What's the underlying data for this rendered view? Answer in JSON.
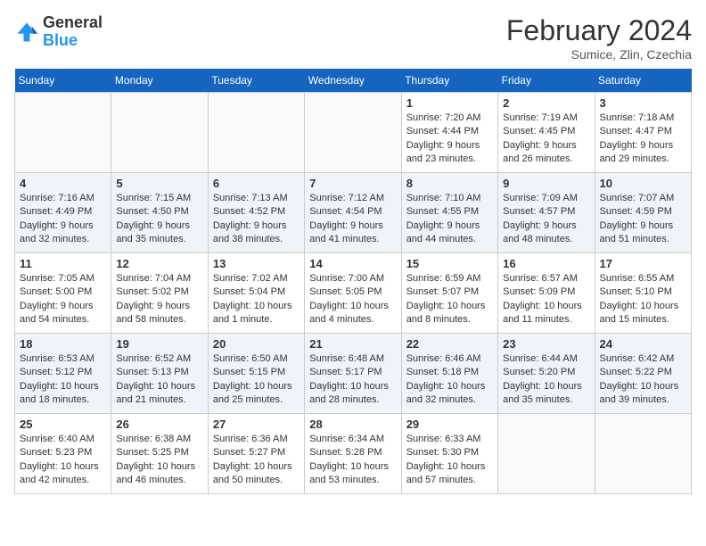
{
  "logo": {
    "general": "General",
    "blue": "Blue"
  },
  "header": {
    "month": "February 2024",
    "location": "Sumice, Zlin, Czechia"
  },
  "weekdays": [
    "Sunday",
    "Monday",
    "Tuesday",
    "Wednesday",
    "Thursday",
    "Friday",
    "Saturday"
  ],
  "weeks": [
    [
      {
        "day": "",
        "info": ""
      },
      {
        "day": "",
        "info": ""
      },
      {
        "day": "",
        "info": ""
      },
      {
        "day": "",
        "info": ""
      },
      {
        "day": "1",
        "info": "Sunrise: 7:20 AM\nSunset: 4:44 PM\nDaylight: 9 hours\nand 23 minutes."
      },
      {
        "day": "2",
        "info": "Sunrise: 7:19 AM\nSunset: 4:45 PM\nDaylight: 9 hours\nand 26 minutes."
      },
      {
        "day": "3",
        "info": "Sunrise: 7:18 AM\nSunset: 4:47 PM\nDaylight: 9 hours\nand 29 minutes."
      }
    ],
    [
      {
        "day": "4",
        "info": "Sunrise: 7:16 AM\nSunset: 4:49 PM\nDaylight: 9 hours\nand 32 minutes."
      },
      {
        "day": "5",
        "info": "Sunrise: 7:15 AM\nSunset: 4:50 PM\nDaylight: 9 hours\nand 35 minutes."
      },
      {
        "day": "6",
        "info": "Sunrise: 7:13 AM\nSunset: 4:52 PM\nDaylight: 9 hours\nand 38 minutes."
      },
      {
        "day": "7",
        "info": "Sunrise: 7:12 AM\nSunset: 4:54 PM\nDaylight: 9 hours\nand 41 minutes."
      },
      {
        "day": "8",
        "info": "Sunrise: 7:10 AM\nSunset: 4:55 PM\nDaylight: 9 hours\nand 44 minutes."
      },
      {
        "day": "9",
        "info": "Sunrise: 7:09 AM\nSunset: 4:57 PM\nDaylight: 9 hours\nand 48 minutes."
      },
      {
        "day": "10",
        "info": "Sunrise: 7:07 AM\nSunset: 4:59 PM\nDaylight: 9 hours\nand 51 minutes."
      }
    ],
    [
      {
        "day": "11",
        "info": "Sunrise: 7:05 AM\nSunset: 5:00 PM\nDaylight: 9 hours\nand 54 minutes."
      },
      {
        "day": "12",
        "info": "Sunrise: 7:04 AM\nSunset: 5:02 PM\nDaylight: 9 hours\nand 58 minutes."
      },
      {
        "day": "13",
        "info": "Sunrise: 7:02 AM\nSunset: 5:04 PM\nDaylight: 10 hours\nand 1 minute."
      },
      {
        "day": "14",
        "info": "Sunrise: 7:00 AM\nSunset: 5:05 PM\nDaylight: 10 hours\nand 4 minutes."
      },
      {
        "day": "15",
        "info": "Sunrise: 6:59 AM\nSunset: 5:07 PM\nDaylight: 10 hours\nand 8 minutes."
      },
      {
        "day": "16",
        "info": "Sunrise: 6:57 AM\nSunset: 5:09 PM\nDaylight: 10 hours\nand 11 minutes."
      },
      {
        "day": "17",
        "info": "Sunrise: 6:55 AM\nSunset: 5:10 PM\nDaylight: 10 hours\nand 15 minutes."
      }
    ],
    [
      {
        "day": "18",
        "info": "Sunrise: 6:53 AM\nSunset: 5:12 PM\nDaylight: 10 hours\nand 18 minutes."
      },
      {
        "day": "19",
        "info": "Sunrise: 6:52 AM\nSunset: 5:13 PM\nDaylight: 10 hours\nand 21 minutes."
      },
      {
        "day": "20",
        "info": "Sunrise: 6:50 AM\nSunset: 5:15 PM\nDaylight: 10 hours\nand 25 minutes."
      },
      {
        "day": "21",
        "info": "Sunrise: 6:48 AM\nSunset: 5:17 PM\nDaylight: 10 hours\nand 28 minutes."
      },
      {
        "day": "22",
        "info": "Sunrise: 6:46 AM\nSunset: 5:18 PM\nDaylight: 10 hours\nand 32 minutes."
      },
      {
        "day": "23",
        "info": "Sunrise: 6:44 AM\nSunset: 5:20 PM\nDaylight: 10 hours\nand 35 minutes."
      },
      {
        "day": "24",
        "info": "Sunrise: 6:42 AM\nSunset: 5:22 PM\nDaylight: 10 hours\nand 39 minutes."
      }
    ],
    [
      {
        "day": "25",
        "info": "Sunrise: 6:40 AM\nSunset: 5:23 PM\nDaylight: 10 hours\nand 42 minutes."
      },
      {
        "day": "26",
        "info": "Sunrise: 6:38 AM\nSunset: 5:25 PM\nDaylight: 10 hours\nand 46 minutes."
      },
      {
        "day": "27",
        "info": "Sunrise: 6:36 AM\nSunset: 5:27 PM\nDaylight: 10 hours\nand 50 minutes."
      },
      {
        "day": "28",
        "info": "Sunrise: 6:34 AM\nSunset: 5:28 PM\nDaylight: 10 hours\nand 53 minutes."
      },
      {
        "day": "29",
        "info": "Sunrise: 6:33 AM\nSunset: 5:30 PM\nDaylight: 10 hours\nand 57 minutes."
      },
      {
        "day": "",
        "info": ""
      },
      {
        "day": "",
        "info": ""
      }
    ]
  ]
}
